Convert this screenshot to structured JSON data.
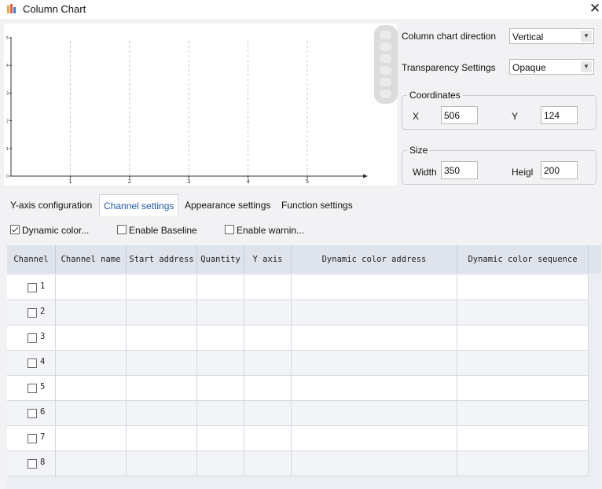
{
  "window": {
    "title": "Column Chart",
    "close_glyph": "✕",
    "icon": "bar-chart-icon"
  },
  "preview": {
    "chart_data": {
      "type": "bar",
      "x_ticks": [
        "1",
        "2",
        "3",
        "4",
        "5"
      ],
      "y_ticks": [
        "0",
        "1",
        "2",
        "3",
        "4",
        "5"
      ],
      "xlim": [
        0,
        5
      ],
      "ylim": [
        0,
        5
      ],
      "grid": "vertical-dashed",
      "series": []
    }
  },
  "properties": {
    "direction": {
      "label": "Column chart direction",
      "value": "Vertical"
    },
    "transparency": {
      "label": "Transparency Settings",
      "value": "Opaque"
    },
    "coordinates": {
      "title": "Coordinates",
      "x_label": "X",
      "x_value": "506",
      "y_label": "Y",
      "y_value": "124"
    },
    "size": {
      "title": "Size",
      "width_label": "Width",
      "width_value": "350",
      "height_label": "Heigl",
      "height_value": "200"
    }
  },
  "tabs": [
    {
      "label": "Y-axis configuration",
      "active": false
    },
    {
      "label": "Channel settings",
      "active": true
    },
    {
      "label": "Appearance settings",
      "active": false
    },
    {
      "label": "Function settings",
      "active": false
    }
  ],
  "options": {
    "dynamic_color": {
      "label": "Dynamic color...",
      "checked": true
    },
    "enable_baseline": {
      "label": "Enable Baseline",
      "checked": false
    },
    "enable_warning": {
      "label": "Enable warnin...",
      "checked": false
    }
  },
  "table": {
    "columns": [
      "Channel",
      "Channel name",
      "Start address",
      "Quantity",
      "Y axis",
      "Dynamic color address",
      "Dynamic color sequence"
    ],
    "rows": [
      {
        "channel": "1",
        "checked": false
      },
      {
        "channel": "2",
        "checked": false
      },
      {
        "channel": "3",
        "checked": false
      },
      {
        "channel": "4",
        "checked": false
      },
      {
        "channel": "5",
        "checked": false
      },
      {
        "channel": "6",
        "checked": false
      },
      {
        "channel": "7",
        "checked": false
      },
      {
        "channel": "8",
        "checked": false
      }
    ]
  },
  "colors": {
    "active_tab_text": "#1e5aa8",
    "header_bg": "#dfe3ec",
    "window_bg": "#f2f2f4"
  }
}
